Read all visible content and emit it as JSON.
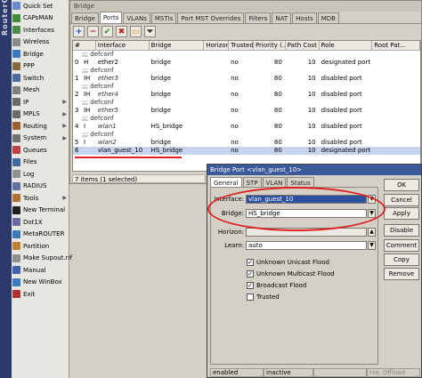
{
  "band_text": "RouterOS WinBox",
  "sidebar": [
    {
      "label": "Quick Set",
      "icon": "quickset-icon",
      "color": "#6a8ad0",
      "arrow": false
    },
    {
      "label": "CAPsMAN",
      "icon": "capsman-icon",
      "color": "#3c8c3c",
      "arrow": false
    },
    {
      "label": "Interfaces",
      "icon": "interfaces-icon",
      "color": "#4a8a4a",
      "arrow": false
    },
    {
      "label": "Wireless",
      "icon": "wireless-icon",
      "color": "#8a8a8a",
      "arrow": false
    },
    {
      "label": "Bridge",
      "icon": "bridge-icon",
      "color": "#3a7ac0",
      "arrow": false
    },
    {
      "label": "PPP",
      "icon": "ppp-icon",
      "color": "#8a6a3a",
      "arrow": false
    },
    {
      "label": "Switch",
      "icon": "switch-icon",
      "color": "#4a6aa0",
      "arrow": false
    },
    {
      "label": "Mesh",
      "icon": "mesh-icon",
      "color": "#808080",
      "arrow": false
    },
    {
      "label": "IP",
      "icon": "ip-icon",
      "color": "#6a6a6a",
      "arrow": true
    },
    {
      "label": "MPLS",
      "icon": "mpls-icon",
      "color": "#6a6a6a",
      "arrow": true
    },
    {
      "label": "Routing",
      "icon": "routing-icon",
      "color": "#a06030",
      "arrow": true
    },
    {
      "label": "System",
      "icon": "system-icon",
      "color": "#707070",
      "arrow": true
    },
    {
      "label": "Queues",
      "icon": "queues-icon",
      "color": "#c04040",
      "arrow": false
    },
    {
      "label": "Files",
      "icon": "files-icon",
      "color": "#3a6aa0",
      "arrow": false
    },
    {
      "label": "Log",
      "icon": "log-icon",
      "color": "#909090",
      "arrow": false
    },
    {
      "label": "RADIUS",
      "icon": "radius-icon",
      "color": "#6070a0",
      "arrow": false
    },
    {
      "label": "Tools",
      "icon": "tools-icon",
      "color": "#b07030",
      "arrow": true
    },
    {
      "label": "New Terminal",
      "icon": "terminal-icon",
      "color": "#202020",
      "arrow": false
    },
    {
      "label": "Dot1X",
      "icon": "dot1x-icon",
      "color": "#6a6aa0",
      "arrow": false
    },
    {
      "label": "MetaROUTER",
      "icon": "metarouter-icon",
      "color": "#3a7ac0",
      "arrow": false
    },
    {
      "label": "Partition",
      "icon": "partition-icon",
      "color": "#c08030",
      "arrow": false
    },
    {
      "label": "Make Supout.rif",
      "icon": "supout-icon",
      "color": "#909090",
      "arrow": false
    },
    {
      "label": "Manual",
      "icon": "manual-icon",
      "color": "#4060b0",
      "arrow": false
    },
    {
      "label": "New WinBox",
      "icon": "winbox-icon",
      "color": "#3a7ac0",
      "arrow": false
    },
    {
      "label": "Exit",
      "icon": "exit-icon",
      "color": "#b03030",
      "arrow": false
    }
  ],
  "bridge_window": {
    "title": "Bridge",
    "tabs": [
      "Bridge",
      "Ports",
      "VLANs",
      "MSTIs",
      "Port MST Overrides",
      "Filters",
      "NAT",
      "Hosts",
      "MDB"
    ],
    "active_tab": 1,
    "toolbar": {
      "add": "+",
      "remove": "−",
      "enable": "✔",
      "disable": "✖",
      "comment": "▭",
      "filter": "⏷"
    },
    "columns": [
      "#",
      "Interface",
      "Bridge",
      "Horizon",
      "Trusted",
      "Priority (...",
      "Path Cost",
      "Role",
      "Root Pat..."
    ],
    "rows": [
      {
        "type": "comment",
        "text": ";;; defconf"
      },
      {
        "type": "data",
        "n": "0",
        "flag": "H",
        "iface": "ether2",
        "bridge": "bridge",
        "horizon": "",
        "trusted": "no",
        "priority": "80",
        "cost": "10",
        "role": "designated port",
        "root": "",
        "italic": false,
        "selected": false
      },
      {
        "type": "comment",
        "text": ";;; defconf"
      },
      {
        "type": "data",
        "n": "1",
        "flag": "IH",
        "iface": "ether3",
        "bridge": "bridge",
        "horizon": "",
        "trusted": "no",
        "priority": "80",
        "cost": "10",
        "role": "disabled port",
        "root": "",
        "italic": true,
        "selected": false
      },
      {
        "type": "comment",
        "text": ";;; defconf"
      },
      {
        "type": "data",
        "n": "2",
        "flag": "IH",
        "iface": "ether4",
        "bridge": "bridge",
        "horizon": "",
        "trusted": "no",
        "priority": "80",
        "cost": "10",
        "role": "disabled port",
        "root": "",
        "italic": true,
        "selected": false
      },
      {
        "type": "comment",
        "text": ";;; defconf"
      },
      {
        "type": "data",
        "n": "3",
        "flag": "IH",
        "iface": "ether5",
        "bridge": "bridge",
        "horizon": "",
        "trusted": "no",
        "priority": "80",
        "cost": "10",
        "role": "disabled port",
        "root": "",
        "italic": true,
        "selected": false
      },
      {
        "type": "comment",
        "text": ";;; defconf"
      },
      {
        "type": "data",
        "n": "4",
        "flag": "I",
        "iface": "wlan1",
        "bridge": "HS_bridge",
        "horizon": "",
        "trusted": "no",
        "priority": "80",
        "cost": "10",
        "role": "disabled port",
        "root": "",
        "italic": true,
        "selected": false
      },
      {
        "type": "comment",
        "text": ";;; defconf"
      },
      {
        "type": "data",
        "n": "5",
        "flag": "I",
        "iface": "wlan2",
        "bridge": "bridge",
        "horizon": "",
        "trusted": "no",
        "priority": "80",
        "cost": "10",
        "role": "disabled port",
        "root": "",
        "italic": true,
        "selected": false
      },
      {
        "type": "data",
        "n": "6",
        "flag": "",
        "iface": "vlan_guest_10",
        "bridge": "HS_bridge",
        "horizon": "",
        "trusted": "no",
        "priority": "80",
        "cost": "10",
        "role": "designated port",
        "root": "",
        "italic": false,
        "selected": true
      }
    ],
    "status": "7 items (1 selected)"
  },
  "dialog": {
    "title": "Bridge Port <vlan_guest_10>",
    "tabs": [
      "General",
      "STP",
      "VLAN",
      "Status"
    ],
    "active_tab": 0,
    "labels": {
      "interface": "Interface:",
      "bridge": "Bridge:",
      "horizon": "Horizon:",
      "learn": "Learn:"
    },
    "values": {
      "interface": "vlan_guest_10",
      "bridge": "HS_bridge",
      "horizon": "",
      "learn": "auto"
    },
    "checks": [
      {
        "label": "Unknown Unicast Flood",
        "checked": true
      },
      {
        "label": "Unknown Multicast Flood",
        "checked": true
      },
      {
        "label": "Broadcast Flood",
        "checked": true
      },
      {
        "label": "Trusted",
        "checked": false
      }
    ],
    "buttons": [
      "OK",
      "Cancel",
      "Apply",
      "Disable",
      "Comment",
      "Copy",
      "Remove"
    ],
    "status": [
      "enabled",
      "inactive",
      "",
      "Hw. Offload"
    ]
  }
}
